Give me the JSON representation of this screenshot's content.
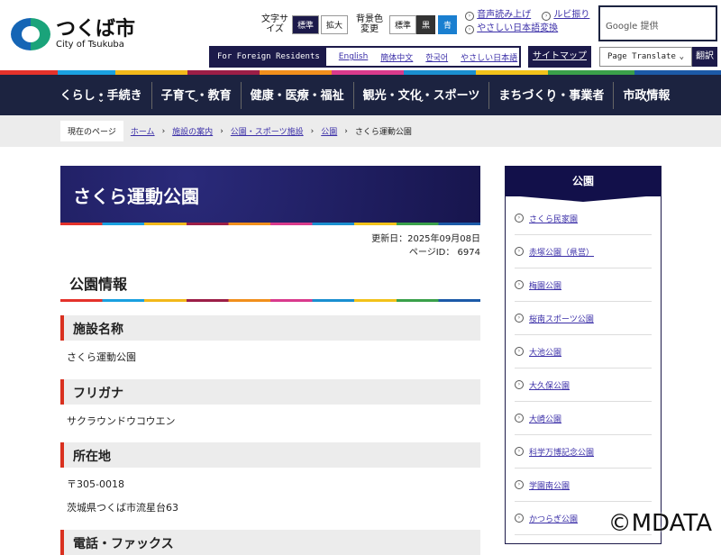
{
  "logo": {
    "jp": "つくば市",
    "en": "City of Tsukuba"
  },
  "font_size": {
    "label": "文字サイズ",
    "standard": "標準",
    "large": "拡大"
  },
  "bg_color": {
    "label": "背景色変更",
    "standard": "標準",
    "black": "黒",
    "blue": "青"
  },
  "tools": {
    "read_aloud": "音声読み上げ",
    "ruby": "ルビ振り",
    "easy_japanese": "やさしい日本語変換"
  },
  "google": {
    "label": "Google 提供"
  },
  "foreign": {
    "title": "For Foreign Residents",
    "links": [
      "English",
      "簡体中文",
      "한국어",
      "やさしい日本語"
    ]
  },
  "sitemap": "サイトマップ",
  "translate": {
    "select": "Page Translate",
    "button": "翻訳"
  },
  "nav": [
    "くらし・手続き",
    "子育て・教育",
    "健康・医療・福祉",
    "観光・文化・スポーツ",
    "まちづくり・事業者",
    "市政情報"
  ],
  "breadcrumb": {
    "here": "現在のページ",
    "items": [
      "ホーム",
      "施設の案内",
      "公園・スポーツ施設",
      "公園"
    ],
    "current": "さくら運動公園"
  },
  "page": {
    "title": "さくら運動公園",
    "updated": "更新日：2025年09月08日",
    "page_id": "ページID： 6974",
    "section": "公園情報"
  },
  "fields": [
    {
      "heading": "施設名称",
      "values": [
        "さくら運動公園"
      ]
    },
    {
      "heading": "フリガナ",
      "values": [
        "サクラウンドウコウエン"
      ]
    },
    {
      "heading": "所在地",
      "values": [
        "〒305-0018",
        "茨城県つくば市流星台63"
      ]
    },
    {
      "heading": "電話・ファックス",
      "values": []
    }
  ],
  "sidebar": {
    "title": "公園",
    "items": [
      "さくら民家園",
      "赤塚公園（県営）",
      "梅園公園",
      "桜南スポーツ公園",
      "大池公園",
      "大久保公園",
      "大崎公園",
      "科学万博記念公園",
      "学園南公園",
      "かつらぎ公園"
    ]
  },
  "watermark": "©MDATA"
}
